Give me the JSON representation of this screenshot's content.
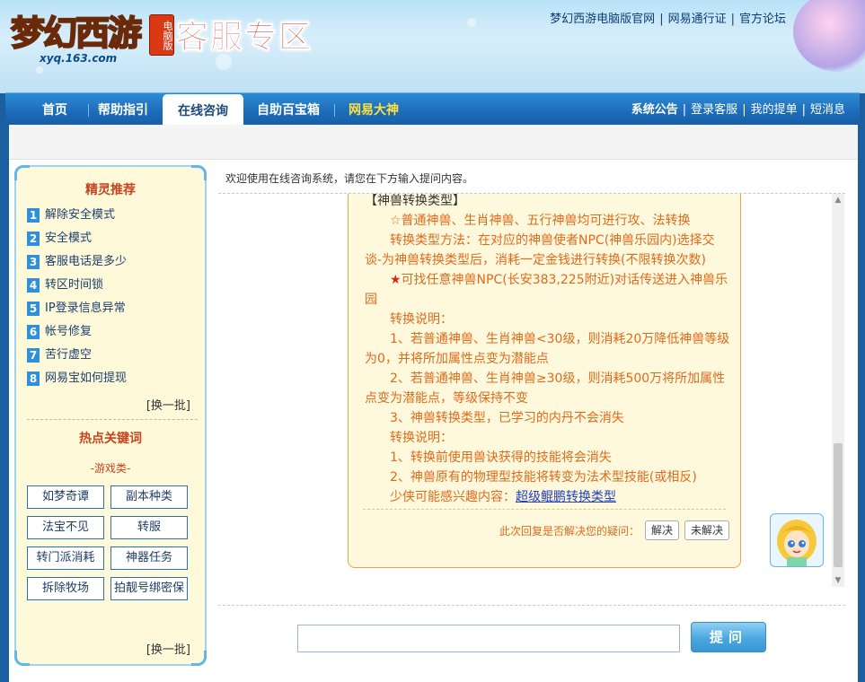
{
  "header": {
    "logo_text": "梦幻西游",
    "logo_badge": "电脑版",
    "logo_url": "xyq.163.com",
    "zone_title": "客服专区",
    "top_links": [
      "梦幻西游电脑版官网",
      "网易通行证",
      "官方论坛"
    ]
  },
  "nav": {
    "items": [
      "首页",
      "帮助指引",
      "在线咨询",
      "自助百宝箱",
      "网易大神"
    ],
    "active": "在线咨询",
    "right_links": [
      "系统公告",
      "登录客服",
      "我的提单",
      "短消息"
    ]
  },
  "sidebar": {
    "rec_title": "精灵推荐",
    "rec_items": [
      {
        "num": "1",
        "label": "解除安全模式"
      },
      {
        "num": "2",
        "label": "安全模式"
      },
      {
        "num": "3",
        "label": "客服电话是多少"
      },
      {
        "num": "4",
        "label": "转区时间锁"
      },
      {
        "num": "5",
        "label": "IP登录信息异常"
      },
      {
        "num": "6",
        "label": "帐号修复"
      },
      {
        "num": "7",
        "label": "苦行虚空"
      },
      {
        "num": "8",
        "label": "网易宝如何提现"
      }
    ],
    "swap_label": "[换一批]",
    "hot_title": "热点关键词",
    "category": "-游戏类-",
    "keywords": [
      "如梦奇谭",
      "副本种类",
      "法宝不见",
      "转服",
      "转门派消耗",
      "神器任务",
      "拆除牧场",
      "拍靓号绑密保"
    ],
    "swap_label_2": "[换一批]"
  },
  "chat": {
    "welcome": "欢迎使用在线咨询系统，请您在下方输入提问内容。",
    "answer": {
      "header": "【神兽转换类型】",
      "line1": "☆普通神兽、生肖神兽、五行神兽均可进行攻、法转换",
      "line2a": "转换类型方法：在对应的神兽使者NPC(神兽乐园内)选择交",
      "line2b": "谈-为神兽转换类型后，消耗一定金钱进行转换(不限转换次数)",
      "star_symbol": "★",
      "line3a": "可找任意神兽NPC(长安383,225附近)对话传送进入神兽乐",
      "line3b": "园",
      "note1": "转换说明：",
      "line4a": "1、若普通神兽、生肖神兽<30级，则消耗20万降低神兽等级",
      "line4b": "为0，并将所加属性点变为潜能点",
      "line5a": "2、若普通神兽、生肖神兽≥30级，则消耗500万将所加属性",
      "line5b": "点变为潜能点，等级保持不变",
      "line6": "3、神兽转换类型，已学习的内丹不会消失",
      "note2": "转换说明：",
      "line7": "1、转换前使用兽诀获得的技能将会消失",
      "line8": "2、神兽原有的物理型技能将转变为法术型技能(或相反)",
      "interest_prompt": "少侠可能感兴趣内容：",
      "interest_link": "超级鲲鹏转换类型"
    },
    "solve_question": "此次回复是否解决您的疑问：",
    "solved_label": "解决",
    "unsolved_label": "未解决"
  },
  "ask": {
    "input_value": "",
    "button_label": "提问"
  },
  "colors": {
    "nav_blue": "#1c6bb8",
    "answer_orange": "#e06a1c",
    "title_red": "#d62a1a",
    "sidebar_bg": "#fdf9d9"
  }
}
